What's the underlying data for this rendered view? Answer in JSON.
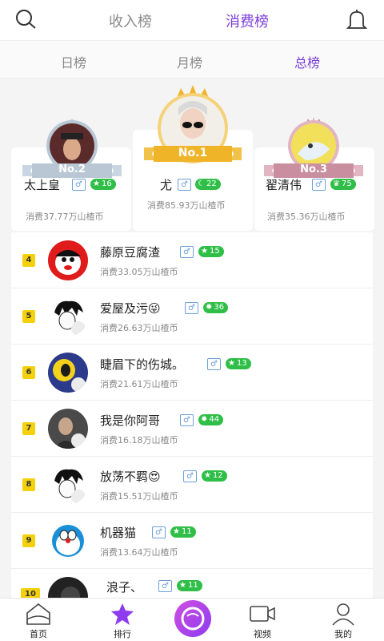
{
  "header": {
    "tabs": [
      {
        "label": "收入榜",
        "active": false
      },
      {
        "label": "消费榜",
        "active": true
      }
    ]
  },
  "subtabs": [
    {
      "label": "日榜",
      "active": false
    },
    {
      "label": "月榜",
      "active": false
    },
    {
      "label": "总榜",
      "active": true
    }
  ],
  "podium": {
    "first": {
      "badge": "No.1",
      "name": "尤",
      "gender": "♂",
      "level": "22",
      "spend": "消费85.93万山楂币"
    },
    "second": {
      "badge": "No.2",
      "name": "太上皇",
      "gender": "♂",
      "level": "16",
      "spend": "消费37.77万山楂币"
    },
    "third": {
      "badge": "No.3",
      "name": "翟清伟",
      "gender": "♂",
      "level": "75",
      "spend": "消费35.36万山楂币"
    }
  },
  "list": [
    {
      "rank": "4",
      "name": "藤原豆腐渣",
      "gender": "♂",
      "level": "15",
      "spend": "消费33.05万山楂币"
    },
    {
      "rank": "5",
      "name": "爱屋及污😜",
      "gender": "♂",
      "level": "36",
      "spend": "消费26.63万山楂币"
    },
    {
      "rank": "6",
      "name": "睫眉下的伤城。",
      "gender": "♂",
      "level": "13",
      "spend": "消费21.61万山楂币"
    },
    {
      "rank": "7",
      "name": "我是你阿哥",
      "gender": "♂",
      "level": "44",
      "spend": "消费16.18万山楂币"
    },
    {
      "rank": "8",
      "name": "放荡不羁😍",
      "gender": "♂",
      "level": "12",
      "spend": "消费15.51万山楂币"
    },
    {
      "rank": "9",
      "name": "机器猫",
      "gender": "♂",
      "level": "11",
      "spend": "消费13.64万山楂币"
    },
    {
      "rank": "10",
      "name": "浪子、",
      "gender": "♂",
      "level": "11",
      "spend": ""
    }
  ],
  "bottomnav": [
    {
      "label": "首页",
      "icon": "home-icon"
    },
    {
      "label": "排行",
      "icon": "star-icon"
    },
    {
      "label": "",
      "icon": "live-camera-icon"
    },
    {
      "label": "视频",
      "icon": "video-icon"
    },
    {
      "label": "我的",
      "icon": "profile-icon"
    }
  ],
  "colors": {
    "accent": "#7b3fd8",
    "level": "#2fbf48",
    "rank": "#f5d10b",
    "gold": "#f0b429",
    "silver": "#b9c6d3",
    "bronze": "#c98fa0"
  }
}
